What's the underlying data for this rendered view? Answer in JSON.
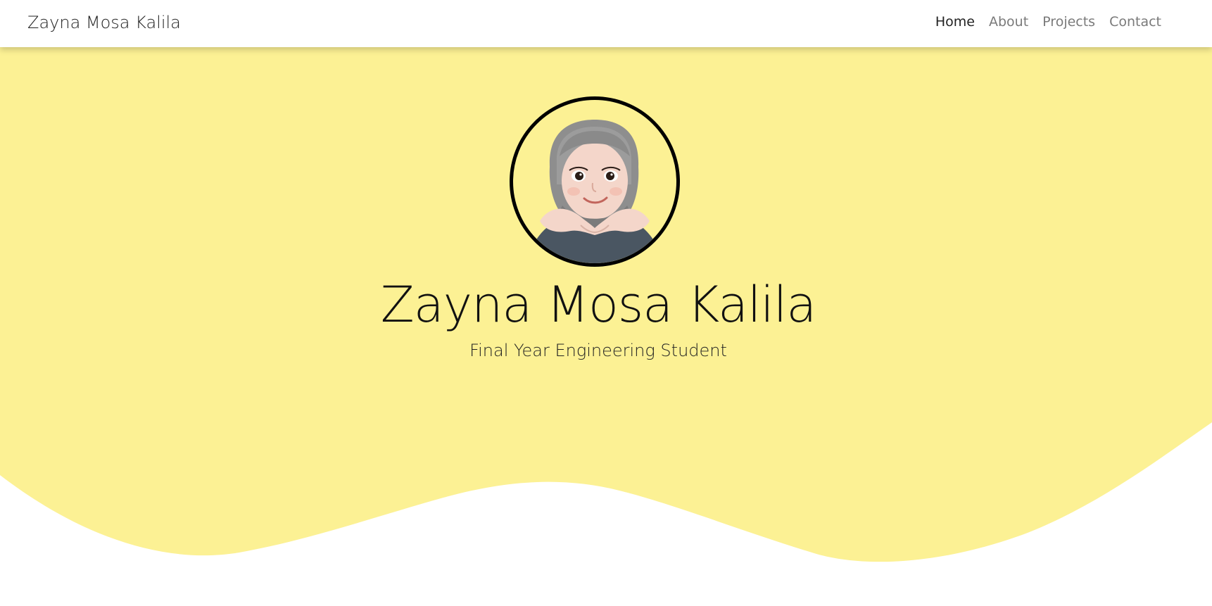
{
  "navbar": {
    "brand": "Zayna Mosa Kalila",
    "links": [
      {
        "label": "Home",
        "active": true
      },
      {
        "label": "About",
        "active": false
      },
      {
        "label": "Projects",
        "active": false
      },
      {
        "label": "Contact",
        "active": false
      }
    ]
  },
  "hero": {
    "name": "Zayna Mosa Kalila",
    "subtitle": "Final Year Engineering Student",
    "avatar_icon": "memoji-avatar-icon"
  },
  "colors": {
    "hero_background": "#fcf194",
    "nav_active": "#222222",
    "nav_inactive": "#7a7a7a",
    "avatar_border": "#000000"
  }
}
